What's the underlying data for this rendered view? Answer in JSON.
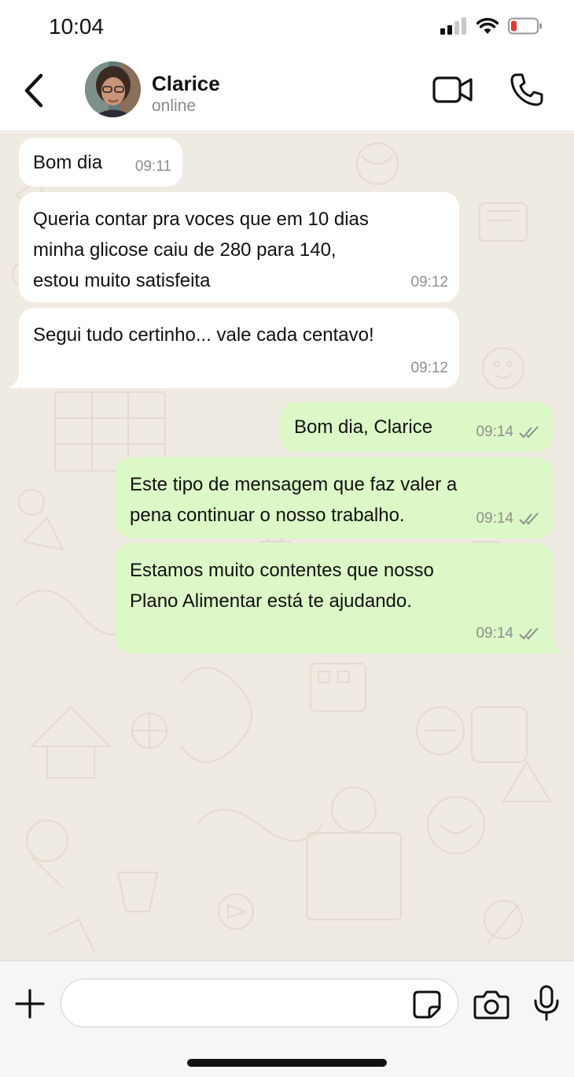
{
  "status_bar": {
    "time": "10:04"
  },
  "header": {
    "contact_name": "Clarice",
    "contact_status": "online"
  },
  "messages": [
    {
      "direction": "in",
      "text": "Bom dia",
      "time": "09:11"
    },
    {
      "direction": "in",
      "text": "Queria contar pra voces que em 10 dias\nminha glicose caiu de 280 para 140,\nestou muito satisfeita",
      "time": "09:12"
    },
    {
      "direction": "in",
      "text": "Segui tudo certinho... vale cada centavo!",
      "time": "09:12"
    },
    {
      "direction": "out",
      "text": "Bom dia, Clarice",
      "time": "09:14",
      "status": "read"
    },
    {
      "direction": "out",
      "text": "Este tipo de mensagem que faz valer a\npena continuar o nosso trabalho.",
      "time": "09:14",
      "status": "read"
    },
    {
      "direction": "out",
      "text": "Estamos muito contentes que nosso\nPlano Alimentar está te ajudando.",
      "time": "09:14",
      "status": "read"
    }
  ],
  "input": {
    "placeholder": ""
  },
  "icons": {
    "back": "chevron-left-icon",
    "video": "video-camera-icon",
    "call": "phone-icon",
    "add": "plus-icon",
    "sticker": "sticker-icon",
    "camera": "camera-icon",
    "mic": "microphone-icon"
  },
  "colors": {
    "chat_background": "#efeae2",
    "incoming_bubble": "#ffffff",
    "outgoing_bubble": "#dcf8c6",
    "battery_low": "#e53935"
  }
}
